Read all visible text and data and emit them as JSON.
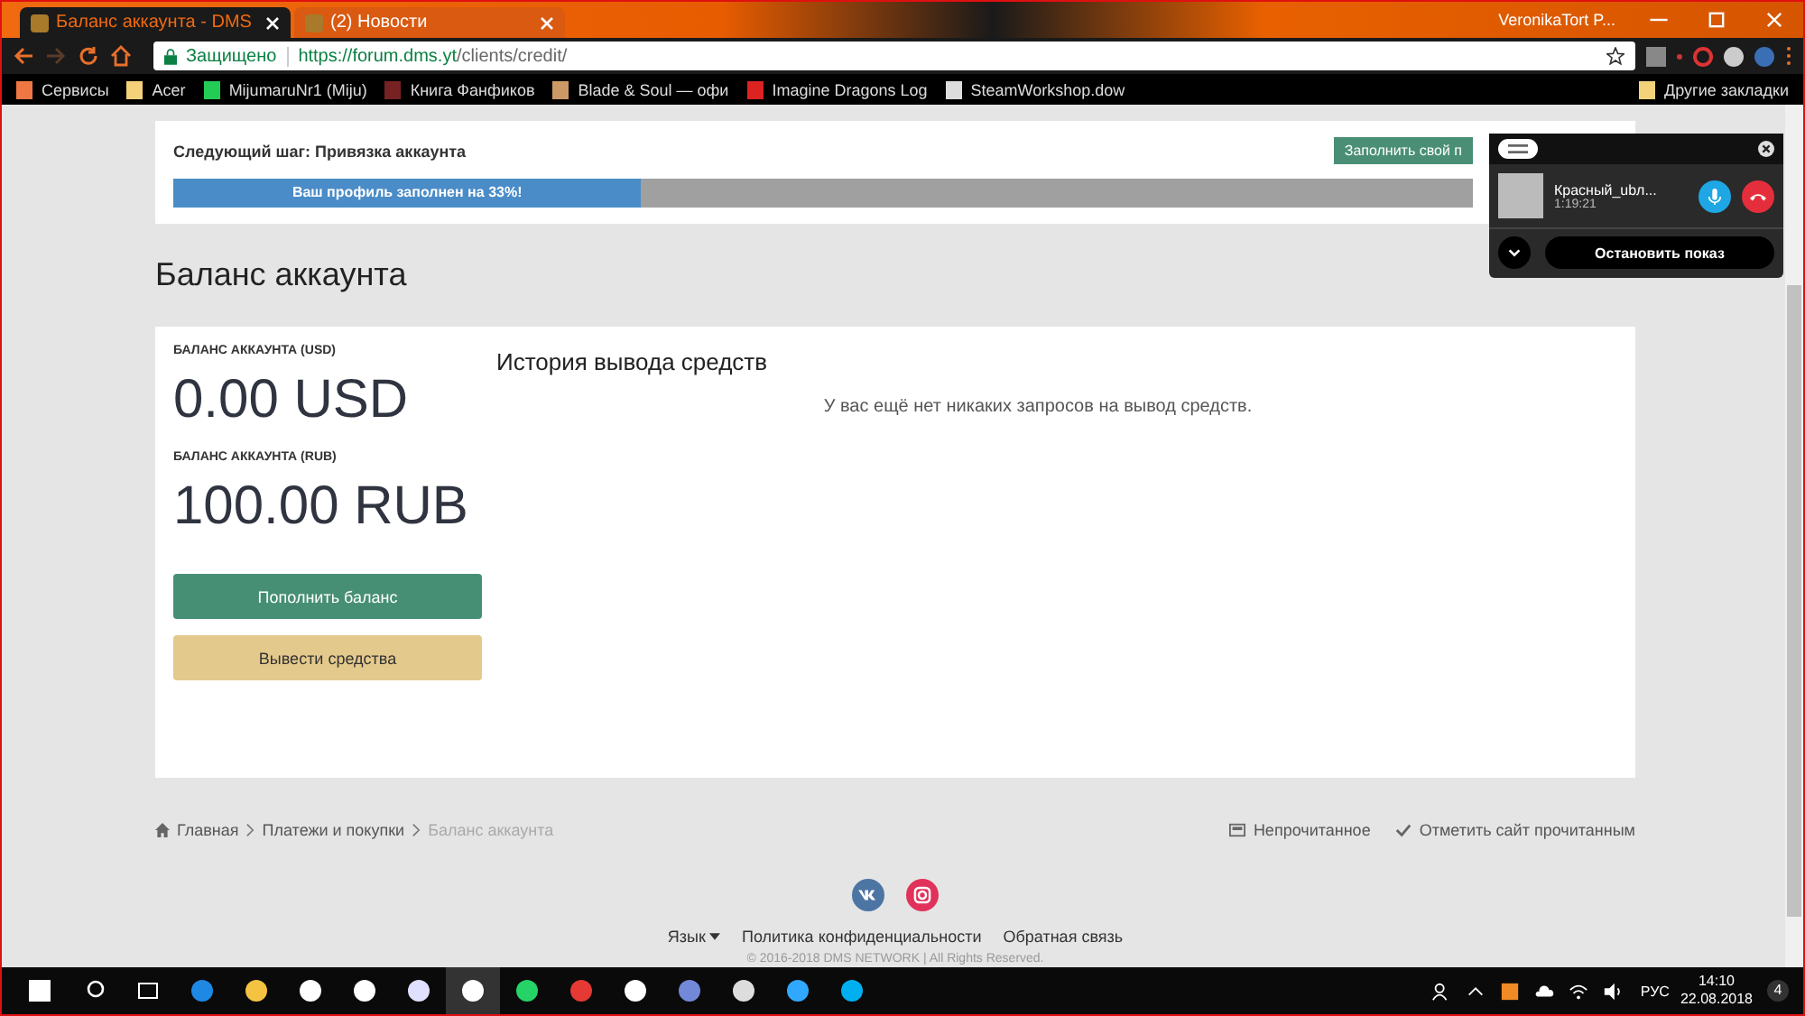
{
  "browser": {
    "tabs": [
      {
        "title": "Баланс аккаунта - DMS",
        "selected": true
      },
      {
        "title": "(2) Новости",
        "selected": false
      }
    ],
    "profile": "VeronikaTort P...",
    "address": {
      "secure_label": "Защищено",
      "url_host": "https://forum.dms.yt",
      "url_path": "/clients/credit/"
    },
    "bookmarks": [
      "Сервисы",
      "Acer",
      "MijumaruNr1 (Miju)",
      "Книга Фанфиков",
      "Blade & Soul — офи",
      "Imagine Dragons Log",
      "SteamWorkshop.dow"
    ],
    "other_bookmarks": "Другие закладки"
  },
  "next_step": {
    "label": "Следующий шаг: Привязка аккаунта",
    "button": "Заполнить свой п",
    "progress": {
      "label": "Ваш профиль заполнен на 33%!",
      "level": 0.36
    }
  },
  "heading": "Баланс аккаунта",
  "balances": [
    {
      "label": "БАЛАНС АККАУНТА (USD)",
      "amount": "0.00 USD"
    },
    {
      "label": "БАЛАНС АККАУНТА (RUB)",
      "amount": "100.00 RUB"
    }
  ],
  "actions": [
    {
      "label": "Пополнить баланс",
      "kind": "primary"
    },
    {
      "label": "Вывести средства",
      "kind": "secondary"
    }
  ],
  "history": {
    "title": "История вывода средств",
    "empty": "У вас ещё нет никаких запросов на вывод средств."
  },
  "breadcrumbs": [
    {
      "label": "Главная",
      "current": false
    },
    {
      "label": "Платежи и покупки",
      "current": false
    },
    {
      "label": "Баланс аккаунта",
      "current": true
    }
  ],
  "footer_actions": [
    "Непрочитанное",
    "Отметить сайт прочитанным"
  ],
  "footer_links": [
    "Язык",
    "Политика конфиденциальности",
    "Обратная связь"
  ],
  "copyright": "© 2016-2018 DMS NETWORK | All Rights Reserved.",
  "skype": {
    "caller": "Красный_ubл...",
    "duration": "1:19:21",
    "stop_button": "Остановить показ"
  },
  "taskbar": {
    "language": "РУС",
    "time": "14:10",
    "date": "22.08.2018",
    "notifications": "4"
  }
}
